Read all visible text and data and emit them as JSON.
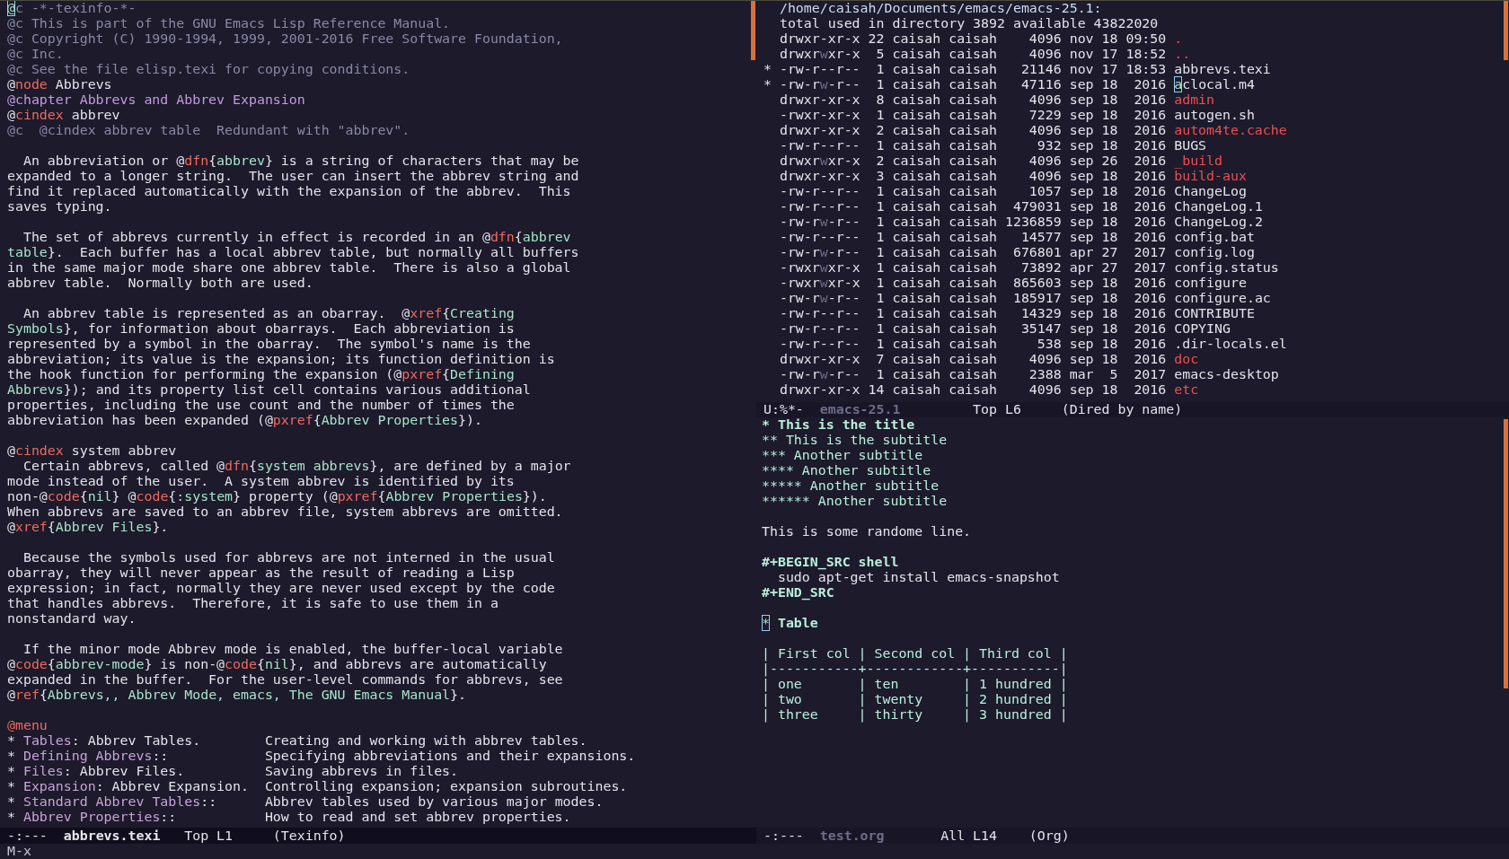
{
  "left_window": {
    "active": true,
    "lines": [
      {
        "spans": [
          {
            "text": "@",
            "kind": "cursor"
          },
          {
            "text": "c -*-texinfo-*-",
            "kind": "comment"
          }
        ]
      },
      {
        "spans": [
          {
            "text": "@c This is part of the GNU Emacs Lisp Reference Manual.",
            "kind": "comment"
          }
        ]
      },
      {
        "spans": [
          {
            "text": "@c Copyright (C) 1990-1994, 1999, 2001-2016 Free Software Foundation,",
            "kind": "comment"
          }
        ]
      },
      {
        "spans": [
          {
            "text": "@c Inc.",
            "kind": "comment"
          }
        ]
      },
      {
        "spans": [
          {
            "text": "@c See the file elisp.texi for copying conditions.",
            "kind": "comment"
          }
        ]
      },
      {
        "spans": [
          {
            "text": "@",
            "kind": "plain"
          },
          {
            "text": "node",
            "kind": "keyword"
          },
          {
            "text": " Abbrevs",
            "kind": "plain"
          }
        ]
      },
      {
        "spans": [
          {
            "text": "@chapter Abbrevs and Abbrev Expansion",
            "kind": "heading"
          }
        ]
      },
      {
        "spans": [
          {
            "text": "@",
            "kind": "plain"
          },
          {
            "text": "cindex",
            "kind": "keyword"
          },
          {
            "text": " abbrev",
            "kind": "plain"
          }
        ]
      },
      {
        "spans": [
          {
            "text": "@c  @cindex abbrev table  Redundant with \"abbrev\".",
            "kind": "comment"
          }
        ]
      },
      {
        "blank_before": true,
        "spans": [
          {
            "text": "  An abbreviation or @",
            "kind": "plain"
          },
          {
            "text": "dfn",
            "kind": "keyword"
          },
          {
            "text": "{",
            "kind": "plain"
          },
          {
            "text": "abbrev",
            "kind": "arg"
          },
          {
            "text": "} is a string of characters that may be",
            "kind": "plain"
          }
        ]
      },
      {
        "spans": [
          {
            "text": "expanded to a longer string.  The user can insert the abbrev string and",
            "kind": "plain"
          }
        ]
      },
      {
        "spans": [
          {
            "text": "find it replaced automatically with the expansion of the abbrev.  This",
            "kind": "plain"
          }
        ]
      },
      {
        "spans": [
          {
            "text": "saves typing.",
            "kind": "plain"
          }
        ]
      },
      {
        "blank_before": true,
        "spans": [
          {
            "text": "  The set of abbrevs currently in effect is recorded in an @",
            "kind": "plain"
          },
          {
            "text": "dfn",
            "kind": "keyword"
          },
          {
            "text": "{",
            "kind": "plain"
          },
          {
            "text": "abbrev",
            "kind": "arg"
          }
        ]
      },
      {
        "spans": [
          {
            "text": "table",
            "kind": "arg"
          },
          {
            "text": "}.  Each buffer has a local abbrev table, but normally all buffers",
            "kind": "plain"
          }
        ]
      },
      {
        "spans": [
          {
            "text": "in the same major mode share one abbrev table.  There is also a global",
            "kind": "plain"
          }
        ]
      },
      {
        "spans": [
          {
            "text": "abbrev table.  Normally both are used.",
            "kind": "plain"
          }
        ]
      },
      {
        "blank_before": true,
        "spans": [
          {
            "text": "  An abbrev table is represented as an obarray.  @",
            "kind": "plain"
          },
          {
            "text": "xref",
            "kind": "keyword"
          },
          {
            "text": "{",
            "kind": "plain"
          },
          {
            "text": "Creating",
            "kind": "arg"
          }
        ]
      },
      {
        "spans": [
          {
            "text": "Symbols",
            "kind": "arg"
          },
          {
            "text": "}, for information about obarrays.  Each abbreviation is",
            "kind": "plain"
          }
        ]
      },
      {
        "spans": [
          {
            "text": "represented by a symbol in the obarray.  The symbol's name is the",
            "kind": "plain"
          }
        ]
      },
      {
        "spans": [
          {
            "text": "abbreviation; its value is the expansion; its function definition is",
            "kind": "plain"
          }
        ]
      },
      {
        "spans": [
          {
            "text": "the hook function for performing the expansion (@",
            "kind": "plain"
          },
          {
            "text": "pxref",
            "kind": "keyword"
          },
          {
            "text": "{",
            "kind": "plain"
          },
          {
            "text": "Defining",
            "kind": "arg"
          }
        ]
      },
      {
        "spans": [
          {
            "text": "Abbrevs",
            "kind": "arg"
          },
          {
            "text": "}); and its property list cell contains various additional",
            "kind": "plain"
          }
        ]
      },
      {
        "spans": [
          {
            "text": "properties, including the use count and the number of times the",
            "kind": "plain"
          }
        ]
      },
      {
        "spans": [
          {
            "text": "abbreviation has been expanded (@",
            "kind": "plain"
          },
          {
            "text": "pxref",
            "kind": "keyword"
          },
          {
            "text": "{",
            "kind": "plain"
          },
          {
            "text": "Abbrev Properties",
            "kind": "arg"
          },
          {
            "text": "}).",
            "kind": "plain"
          }
        ]
      },
      {
        "blank_before": true,
        "spans": [
          {
            "text": "@",
            "kind": "plain"
          },
          {
            "text": "cindex",
            "kind": "keyword"
          },
          {
            "text": " system abbrev",
            "kind": "plain"
          }
        ]
      },
      {
        "spans": [
          {
            "text": "  Certain abbrevs, called @",
            "kind": "plain"
          },
          {
            "text": "dfn",
            "kind": "keyword"
          },
          {
            "text": "{",
            "kind": "plain"
          },
          {
            "text": "system abbrevs",
            "kind": "arg"
          },
          {
            "text": "}, are defined by a major",
            "kind": "plain"
          }
        ]
      },
      {
        "spans": [
          {
            "text": "mode instead of the user.  A system abbrev is identified by its",
            "kind": "plain"
          }
        ]
      },
      {
        "spans": [
          {
            "text": "non-@",
            "kind": "plain"
          },
          {
            "text": "code",
            "kind": "keyword"
          },
          {
            "text": "{",
            "kind": "plain"
          },
          {
            "text": "nil",
            "kind": "arg"
          },
          {
            "text": "} @",
            "kind": "plain"
          },
          {
            "text": "code",
            "kind": "keyword"
          },
          {
            "text": "{",
            "kind": "plain"
          },
          {
            "text": ":system",
            "kind": "arg"
          },
          {
            "text": "} property (@",
            "kind": "plain"
          },
          {
            "text": "pxref",
            "kind": "keyword"
          },
          {
            "text": "{",
            "kind": "plain"
          },
          {
            "text": "Abbrev Properties",
            "kind": "arg"
          },
          {
            "text": "}).",
            "kind": "plain"
          }
        ]
      },
      {
        "spans": [
          {
            "text": "When abbrevs are saved to an abbrev file, system abbrevs are omitted.",
            "kind": "plain"
          }
        ]
      },
      {
        "spans": [
          {
            "text": "@",
            "kind": "plain"
          },
          {
            "text": "xref",
            "kind": "keyword"
          },
          {
            "text": "{",
            "kind": "plain"
          },
          {
            "text": "Abbrev Files",
            "kind": "arg"
          },
          {
            "text": "}.",
            "kind": "plain"
          }
        ]
      },
      {
        "blank_before": true,
        "spans": [
          {
            "text": "  Because the symbols used for abbrevs are not interned in the usual",
            "kind": "plain"
          }
        ]
      },
      {
        "spans": [
          {
            "text": "obarray, they will never appear as the result of reading a Lisp",
            "kind": "plain"
          }
        ]
      },
      {
        "spans": [
          {
            "text": "expression; in fact, normally they are never used except by the code",
            "kind": "plain"
          }
        ]
      },
      {
        "spans": [
          {
            "text": "that handles abbrevs.  Therefore, it is safe to use them in a",
            "kind": "plain"
          }
        ]
      },
      {
        "spans": [
          {
            "text": "nonstandard way.",
            "kind": "plain"
          }
        ]
      },
      {
        "blank_before": true,
        "spans": [
          {
            "text": "  If the minor mode Abbrev mode is enabled, the buffer-local variable",
            "kind": "plain"
          }
        ]
      },
      {
        "spans": [
          {
            "text": "@",
            "kind": "plain"
          },
          {
            "text": "code",
            "kind": "keyword"
          },
          {
            "text": "{",
            "kind": "plain"
          },
          {
            "text": "abbrev-mode",
            "kind": "arg"
          },
          {
            "text": "} is non-@",
            "kind": "plain"
          },
          {
            "text": "code",
            "kind": "keyword"
          },
          {
            "text": "{",
            "kind": "plain"
          },
          {
            "text": "nil",
            "kind": "arg"
          },
          {
            "text": "}, and abbrevs are automatically",
            "kind": "plain"
          }
        ]
      },
      {
        "spans": [
          {
            "text": "expanded in the buffer.  For the user-level commands for abbrevs, see",
            "kind": "plain"
          }
        ]
      },
      {
        "spans": [
          {
            "text": "@",
            "kind": "plain"
          },
          {
            "text": "ref",
            "kind": "keyword"
          },
          {
            "text": "{",
            "kind": "plain"
          },
          {
            "text": "Abbrevs,, Abbrev Mode, emacs, The GNU Emacs Manual",
            "kind": "arg"
          },
          {
            "text": "}.",
            "kind": "plain"
          }
        ]
      },
      {
        "blank_before": true,
        "spans": [
          {
            "text": "@menu",
            "kind": "keyword"
          }
        ]
      },
      {
        "spans": [
          {
            "text": "* ",
            "kind": "plain"
          },
          {
            "text": "Tables",
            "kind": "menu"
          },
          {
            "text": ": Abbrev Tables.        Creating and working with abbrev tables.",
            "kind": "plain"
          }
        ]
      },
      {
        "spans": [
          {
            "text": "* ",
            "kind": "plain"
          },
          {
            "text": "Defining Abbrevs",
            "kind": "menu"
          },
          {
            "text": "::            Specifying abbreviations and their expansions.",
            "kind": "plain"
          }
        ]
      },
      {
        "spans": [
          {
            "text": "* ",
            "kind": "plain"
          },
          {
            "text": "Files",
            "kind": "menu"
          },
          {
            "text": ": Abbrev Files.          Saving abbrevs in files.",
            "kind": "plain"
          }
        ]
      },
      {
        "spans": [
          {
            "text": "* ",
            "kind": "plain"
          },
          {
            "text": "Expansion",
            "kind": "menu"
          },
          {
            "text": ": Abbrev Expansion.  Controlling expansion; expansion subroutines.",
            "kind": "plain"
          }
        ]
      },
      {
        "spans": [
          {
            "text": "* ",
            "kind": "plain"
          },
          {
            "text": "Standard Abbrev Tables",
            "kind": "menu"
          },
          {
            "text": "::      Abbrev tables used by various major modes.",
            "kind": "plain"
          }
        ]
      },
      {
        "spans": [
          {
            "text": "* ",
            "kind": "plain"
          },
          {
            "text": "Abbrev Properties",
            "kind": "menu"
          },
          {
            "text": "::           How to read and set abbrev properties.",
            "kind": "plain"
          }
        ]
      }
    ],
    "mode_line": [
      {
        "text": "-:---  ",
        "kind": "plain"
      },
      {
        "text": "abbrevs.texi",
        "kind": "bold"
      },
      {
        "text": "   Top L1     (Texinfo)",
        "kind": "plain"
      }
    ]
  },
  "dired_window": {
    "active": false,
    "lines": [
      {
        "spans": [
          {
            "text": "  /home/caisah/Documents/emacs/emacs-25.1:",
            "kind": "path"
          }
        ]
      },
      {
        "spans": [
          {
            "text": "  total used in directory 3892 available 43822020",
            "kind": "plain"
          }
        ]
      },
      {
        "spans": [
          {
            "text": "  drwxr-xr-x 22 caisah caisah    4096 nov 18 09:50 ",
            "kind": "plain"
          },
          {
            "text": ".",
            "kind": "dir"
          }
        ]
      },
      {
        "spans": [
          {
            "text": "  drwxr",
            "kind": "plain"
          },
          {
            "text": "w",
            "kind": "dim"
          },
          {
            "text": "xr-x  5 caisah caisah    4096 nov 17 18:52 ",
            "kind": "plain"
          },
          {
            "text": "..",
            "kind": "dir"
          }
        ]
      },
      {
        "spans": [
          {
            "text": "*",
            "kind": "mark"
          },
          {
            "text": " -rw-r--r--  1 caisah caisah   21146 nov 17 18:53 abbrevs.texi",
            "kind": "plain"
          }
        ]
      },
      {
        "spans": [
          {
            "text": "*",
            "kind": "mark"
          },
          {
            "text": " -rw-r",
            "kind": "plain"
          },
          {
            "text": "w",
            "kind": "dim"
          },
          {
            "text": "-r--  1 caisah caisah   47116 sep 18  2016 ",
            "kind": "plain"
          },
          {
            "text": "a",
            "kind": "cursor"
          },
          {
            "text": "clocal.m4",
            "kind": "plain"
          }
        ]
      },
      {
        "spans": [
          {
            "text": "  drwxr-xr-x  8 caisah caisah    4096 sep 18  2016 ",
            "kind": "plain"
          },
          {
            "text": "admin",
            "kind": "dir"
          }
        ]
      },
      {
        "spans": [
          {
            "text": "  -rwxr-xr-x  1 caisah caisah    7229 sep 18  2016 autogen.sh",
            "kind": "plain"
          }
        ]
      },
      {
        "spans": [
          {
            "text": "  drwxr-xr-x  2 caisah caisah    4096 sep 18  2016 ",
            "kind": "plain"
          },
          {
            "text": "autom4te.cache",
            "kind": "dir"
          }
        ]
      },
      {
        "spans": [
          {
            "text": "  -rw-r--r--  1 caisah caisah     932 sep 18  2016 BUGS",
            "kind": "plain"
          }
        ]
      },
      {
        "spans": [
          {
            "text": "  drwxr",
            "kind": "plain"
          },
          {
            "text": "w",
            "kind": "dim"
          },
          {
            "text": "xr-x  2 caisah caisah    4096 sep 26  2016 ",
            "kind": "plain"
          },
          {
            "text": "_build",
            "kind": "dir"
          }
        ]
      },
      {
        "spans": [
          {
            "text": "  drwxr-xr-x  3 caisah caisah    4096 sep 18  2016 ",
            "kind": "plain"
          },
          {
            "text": "build-aux",
            "kind": "dir"
          }
        ]
      },
      {
        "spans": [
          {
            "text": "  -rw-r--r--  1 caisah caisah    1057 sep 18  2016 ChangeLog",
            "kind": "plain"
          }
        ]
      },
      {
        "spans": [
          {
            "text": "  -rw-r--r--  1 caisah caisah  479031 sep 18  2016 ChangeLog.1",
            "kind": "plain"
          }
        ]
      },
      {
        "spans": [
          {
            "text": "  -rw-r",
            "kind": "plain"
          },
          {
            "text": "w",
            "kind": "dim"
          },
          {
            "text": "-r--  1 caisah caisah 1236859 sep 18  2016 ChangeLog.2",
            "kind": "plain"
          }
        ]
      },
      {
        "spans": [
          {
            "text": "  -rw-r--r--  1 caisah caisah   14577 sep 18  2016 config.bat",
            "kind": "plain"
          }
        ]
      },
      {
        "spans": [
          {
            "text": "  -rw-r",
            "kind": "plain"
          },
          {
            "text": "w",
            "kind": "dim"
          },
          {
            "text": "-r--  1 caisah caisah  676801 apr 27  2017 config.log",
            "kind": "plain"
          }
        ]
      },
      {
        "spans": [
          {
            "text": "  -rwxr",
            "kind": "plain"
          },
          {
            "text": "w",
            "kind": "dim"
          },
          {
            "text": "xr-x  1 caisah caisah   73892 apr 27  2017 config.status",
            "kind": "plain"
          }
        ]
      },
      {
        "spans": [
          {
            "text": "  -rwxr",
            "kind": "plain"
          },
          {
            "text": "w",
            "kind": "dim"
          },
          {
            "text": "xr-x  1 caisah caisah  865603 sep 18  2016 configure",
            "kind": "plain"
          }
        ]
      },
      {
        "spans": [
          {
            "text": "  -rw-r",
            "kind": "plain"
          },
          {
            "text": "w",
            "kind": "dim"
          },
          {
            "text": "-r--  1 caisah caisah  185917 sep 18  2016 configure.ac",
            "kind": "plain"
          }
        ]
      },
      {
        "spans": [
          {
            "text": "  -rw-r--r--  1 caisah caisah   14329 sep 18  2016 CONTRIBUTE",
            "kind": "plain"
          }
        ]
      },
      {
        "spans": [
          {
            "text": "  -rw-r--r--  1 caisah caisah   35147 sep 18  2016 COPYING",
            "kind": "plain"
          }
        ]
      },
      {
        "spans": [
          {
            "text": "  -rw-r--r--  1 caisah caisah     538 sep 18  2016 .dir-locals.el",
            "kind": "plain"
          }
        ]
      },
      {
        "spans": [
          {
            "text": "  drwxr-xr-x  7 caisah caisah    4096 sep 18  2016 ",
            "kind": "plain"
          },
          {
            "text": "doc",
            "kind": "dir"
          }
        ]
      },
      {
        "spans": [
          {
            "text": "  -rw-r",
            "kind": "plain"
          },
          {
            "text": "w",
            "kind": "dim"
          },
          {
            "text": "-r--  1 caisah caisah    2388 mar  5  2017 emacs-desktop",
            "kind": "plain"
          }
        ]
      },
      {
        "spans": [
          {
            "text": "  drwxr-xr-x 14 caisah caisah    4096 sep 18  2016 ",
            "kind": "plain"
          },
          {
            "text": "etc",
            "kind": "dir"
          }
        ]
      }
    ],
    "mode_line": [
      {
        "text": "U:%*-  ",
        "kind": "plain"
      },
      {
        "text": "emacs-25.1",
        "kind": "bold"
      },
      {
        "text": "         Top L6     (Dired by name)",
        "kind": "plain"
      }
    ]
  },
  "org_window": {
    "active": false,
    "lines": [
      {
        "spans": [
          {
            "text": "* This is the title",
            "kind": "title"
          }
        ]
      },
      {
        "spans": [
          {
            "text": "** This is the subtitle",
            "kind": "org"
          }
        ]
      },
      {
        "spans": [
          {
            "text": "*** Another subtitle",
            "kind": "org"
          }
        ]
      },
      {
        "spans": [
          {
            "text": "**** Another subtitle",
            "kind": "org"
          }
        ]
      },
      {
        "spans": [
          {
            "text": "***** Another subtitle",
            "kind": "org"
          }
        ]
      },
      {
        "spans": [
          {
            "text": "****** Another subtitle",
            "kind": "org"
          }
        ]
      },
      {
        "blank_before": true,
        "spans": [
          {
            "text": "This is some randome line.",
            "kind": "plain"
          }
        ]
      },
      {
        "blank_before": true,
        "spans": [
          {
            "text": "#+BEGIN_SRC shell",
            "kind": "title"
          }
        ]
      },
      {
        "spans": [
          {
            "text": "  sudo apt-get install emacs-snapshot",
            "kind": "plain"
          }
        ]
      },
      {
        "spans": [
          {
            "text": "#+END_SRC",
            "kind": "title"
          }
        ]
      },
      {
        "blank_before": true,
        "spans": [
          {
            "text": "*",
            "kind": "cursor"
          },
          {
            "text": " Table",
            "kind": "title"
          }
        ]
      },
      {
        "blank_before": true,
        "spans": [
          {
            "text": "| First col | Second col | Third col |",
            "kind": "org"
          }
        ]
      },
      {
        "spans": [
          {
            "text": "|-----------+------------+-----------|",
            "kind": "org"
          }
        ]
      },
      {
        "spans": [
          {
            "text": "| one       | ten        | 1 hundred |",
            "kind": "org"
          }
        ]
      },
      {
        "spans": [
          {
            "text": "| two       | twenty     | 2 hundred |",
            "kind": "org"
          }
        ]
      },
      {
        "spans": [
          {
            "text": "| three     | thirty     | 3 hundred |",
            "kind": "org"
          }
        ]
      }
    ],
    "mode_line": [
      {
        "text": "-:---  ",
        "kind": "plain"
      },
      {
        "text": "test.org",
        "kind": "bold"
      },
      {
        "text": "       All L14    (Org)",
        "kind": "plain"
      }
    ]
  },
  "minibuffer": "M-x"
}
